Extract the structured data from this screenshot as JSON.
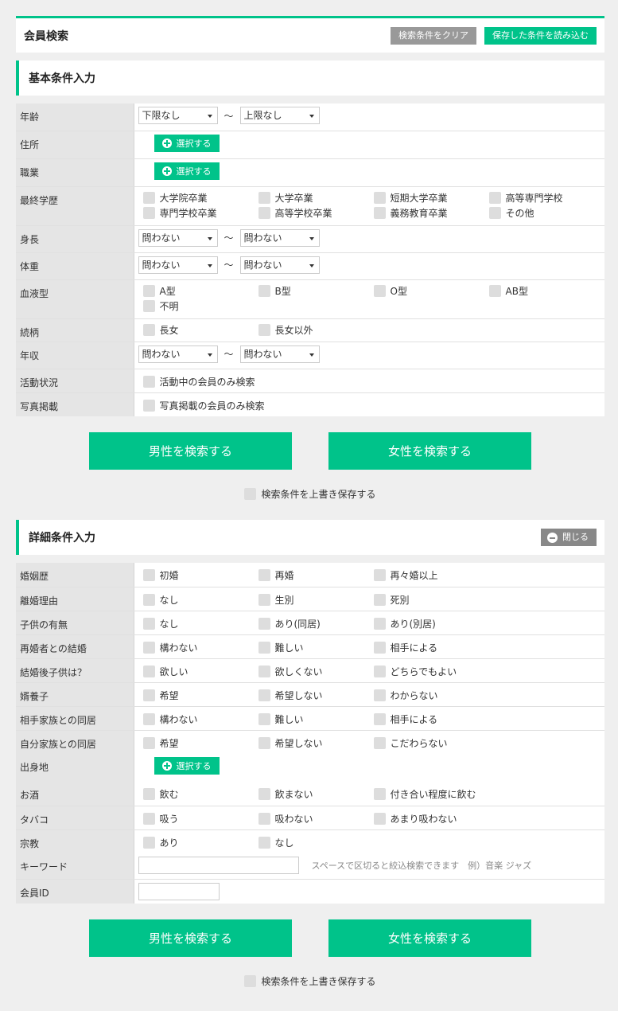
{
  "header": {
    "title": "会員検索",
    "clear_label": "検索条件をクリア",
    "load_label": "保存した条件を読み込む"
  },
  "basic": {
    "title": "基本条件入力",
    "age": {
      "label": "年齢",
      "from": "下限なし",
      "to": "上限なし",
      "sep": "〜"
    },
    "address": {
      "label": "住所",
      "btn": "選択する"
    },
    "job": {
      "label": "職業",
      "btn": "選択する"
    },
    "education": {
      "label": "最終学歴",
      "options": [
        "大学院卒業",
        "大学卒業",
        "短期大学卒業",
        "高等専門学校",
        "専門学校卒業",
        "高等学校卒業",
        "義務教育卒業",
        "その他"
      ]
    },
    "height": {
      "label": "身長",
      "from": "問わない",
      "to": "問わない",
      "sep": "〜"
    },
    "weight": {
      "label": "体重",
      "from": "問わない",
      "to": "問わない",
      "sep": "〜"
    },
    "blood": {
      "label": "血液型",
      "options": [
        "A型",
        "B型",
        "O型",
        "AB型",
        "不明"
      ]
    },
    "relation": {
      "label": "続柄",
      "options": [
        "長女",
        "長女以外"
      ]
    },
    "income": {
      "label": "年収",
      "from": "問わない",
      "to": "問わない",
      "sep": "〜"
    },
    "activity": {
      "label": "活動状況",
      "options": [
        "活動中の会員のみ検索"
      ]
    },
    "photo": {
      "label": "写真掲載",
      "options": [
        "写真掲載の会員のみ検索"
      ]
    }
  },
  "search1": {
    "male": "男性を検索する",
    "female": "女性を検索する",
    "save": "検索条件を上書き保存する"
  },
  "detail": {
    "title": "詳細条件入力",
    "close": "閉じる",
    "rows": [
      {
        "label": "婚姻歴",
        "options": [
          "初婚",
          "再婚",
          "再々婚以上"
        ]
      },
      {
        "label": "離婚理由",
        "options": [
          "なし",
          "生別",
          "死別"
        ]
      },
      {
        "label": "子供の有無",
        "options": [
          "なし",
          "あり(同居)",
          "あり(別居)"
        ]
      },
      {
        "label": "再婚者との結婚",
        "options": [
          "構わない",
          "難しい",
          "相手による"
        ]
      },
      {
        "label": "結婚後子供は？",
        "options": [
          "欲しい",
          "欲しくない",
          "どちらでもよい"
        ]
      },
      {
        "label": "婿養子",
        "options": [
          "希望",
          "希望しない",
          "わからない"
        ]
      },
      {
        "label": "相手家族との同居",
        "options": [
          "構わない",
          "難しい",
          "相手による"
        ]
      },
      {
        "label": "自分家族との同居",
        "options": [
          "希望",
          "希望しない",
          "こだわらない"
        ]
      }
    ],
    "origin": {
      "label": "出身地",
      "btn": "選択する"
    },
    "rows2": [
      {
        "label": "お酒",
        "options": [
          "飲む",
          "飲まない",
          "付き合い程度に飲む"
        ]
      },
      {
        "label": "タバコ",
        "options": [
          "吸う",
          "吸わない",
          "あまり吸わない"
        ]
      },
      {
        "label": "宗教",
        "options": [
          "あり",
          "なし"
        ]
      }
    ],
    "keyword": {
      "label": "キーワード",
      "hint": "スペースで区切ると絞込検索できます　例）音楽 ジャズ"
    },
    "member_id": {
      "label": "会員ID"
    }
  },
  "search2": {
    "male": "男性を検索する",
    "female": "女性を検索する",
    "save": "検索条件を上書き保存する"
  }
}
